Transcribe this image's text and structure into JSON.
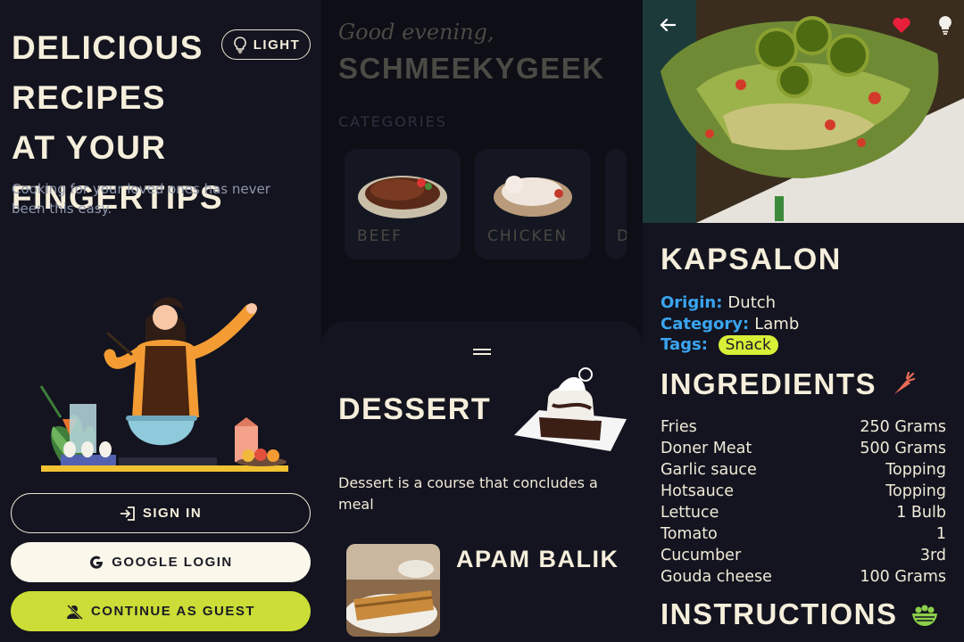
{
  "welcome": {
    "headline": "Delicious recipes at your fingertips",
    "theme_label": "LIGHT",
    "subtitle": "Cooking for your loved ones has never been this easy.",
    "signin_label": "SIGN IN",
    "google_label": "GOOGLE LOGIN",
    "guest_label": "CONTINUE AS GUEST"
  },
  "home": {
    "greeting": "Good evening,",
    "username": "SCHMEEKYGEEK",
    "categories_title": "CATEGORIES",
    "categories": [
      {
        "label": "BEEF"
      },
      {
        "label": "CHICKEN"
      },
      {
        "label": "D"
      }
    ],
    "sheet": {
      "title": "DESSERT",
      "description": "Dessert is a course that concludes a meal",
      "meals": [
        {
          "name": "APAM BALIK"
        }
      ]
    }
  },
  "recipe": {
    "title": "KAPSALON",
    "origin_key": "Origin:",
    "origin_value": "Dutch",
    "category_key": "Category:",
    "category_value": "Lamb",
    "tags_key": "Tags:",
    "tags": [
      "Snack"
    ],
    "ingredients_title": "INGREDIENTS",
    "ingredients": [
      {
        "name": "Fries",
        "amount": "250 Grams"
      },
      {
        "name": "Doner Meat",
        "amount": "500 Grams"
      },
      {
        "name": "Garlic sauce",
        "amount": "Topping"
      },
      {
        "name": "Hotsauce",
        "amount": "Topping"
      },
      {
        "name": "Lettuce",
        "amount": "1 Bulb"
      },
      {
        "name": "Tomato",
        "amount": "1"
      },
      {
        "name": "Cucumber",
        "amount": "3rd"
      },
      {
        "name": "Gouda cheese",
        "amount": "100 Grams"
      }
    ],
    "instructions_title": "INSTRUCTIONS"
  },
  "colors": {
    "accent_lime": "#cbdd36",
    "tag_lime": "#d8ef38",
    "meta_blue": "#3aa5f0",
    "favorite_red": "#e8203c",
    "background": "#13141f"
  },
  "icons": [
    "lightbulb-icon",
    "sign-in-icon",
    "google-icon",
    "guest-icon",
    "back-arrow-icon",
    "heart-icon",
    "carrot-icon",
    "bowl-icon"
  ]
}
